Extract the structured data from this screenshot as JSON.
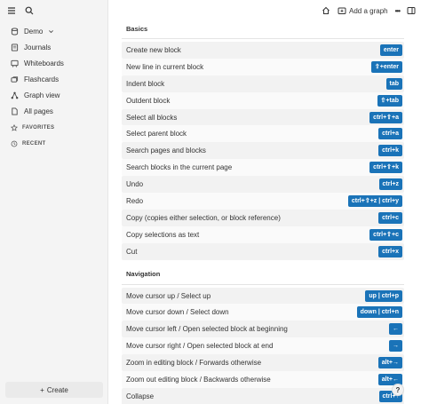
{
  "sidebar": {
    "graph_name": "Demo",
    "items": [
      {
        "label": "Journals",
        "icon": "calendar-icon"
      },
      {
        "label": "Whiteboards",
        "icon": "whiteboard-icon"
      },
      {
        "label": "Flashcards",
        "icon": "flashcards-icon"
      },
      {
        "label": "Graph view",
        "icon": "graph-icon"
      },
      {
        "label": "All pages",
        "icon": "pages-icon"
      }
    ],
    "favorites_label": "FAVORITES",
    "recent_label": "RECENT",
    "create_label": "Create"
  },
  "topbar": {
    "add_graph_label": "Add a graph",
    "more_label": "•••"
  },
  "main": {
    "basics_title": "Basics",
    "basics": [
      {
        "label": "Create new block",
        "key": "enter"
      },
      {
        "label": "New line in current block",
        "key": "⇧+enter"
      },
      {
        "label": "Indent block",
        "key": "tab"
      },
      {
        "label": "Outdent block",
        "key": "⇧+tab"
      },
      {
        "label": "Select all blocks",
        "key": "ctrl+⇧+a"
      },
      {
        "label": "Select parent block",
        "key": "ctrl+a"
      },
      {
        "label": "Search pages and blocks",
        "key": "ctrl+k"
      },
      {
        "label": "Search blocks in the current page",
        "key": "ctrl+⇧+k"
      },
      {
        "label": "Undo",
        "key": "ctrl+z"
      },
      {
        "label": "Redo",
        "key": "ctrl+⇧+z | ctrl+y"
      },
      {
        "label": "Copy (copies either selection, or block reference)",
        "key": "ctrl+c"
      },
      {
        "label": "Copy selections as text",
        "key": "ctrl+⇧+c"
      },
      {
        "label": "Cut",
        "key": "ctrl+x"
      }
    ],
    "navigation_title": "Navigation",
    "navigation": [
      {
        "label": "Move cursor up / Select up",
        "key": "up | ctrl+p"
      },
      {
        "label": "Move cursor down / Select down",
        "key": "down | ctrl+n"
      },
      {
        "label": "Move cursor left / Open selected block at beginning",
        "key": "←"
      },
      {
        "label": "Move cursor right / Open selected block at end",
        "key": "→"
      },
      {
        "label": "Zoom in editing block / Forwards otherwise",
        "key": "alt+→"
      },
      {
        "label": "Zoom out editing block / Backwards otherwise",
        "key": "alt+←"
      },
      {
        "label": "Collapse",
        "key": "ctrl+↑"
      }
    ]
  },
  "help_label": "?",
  "colors": {
    "key_bg": "#1a73b8",
    "sidebar_bg": "#f4f4f4"
  }
}
